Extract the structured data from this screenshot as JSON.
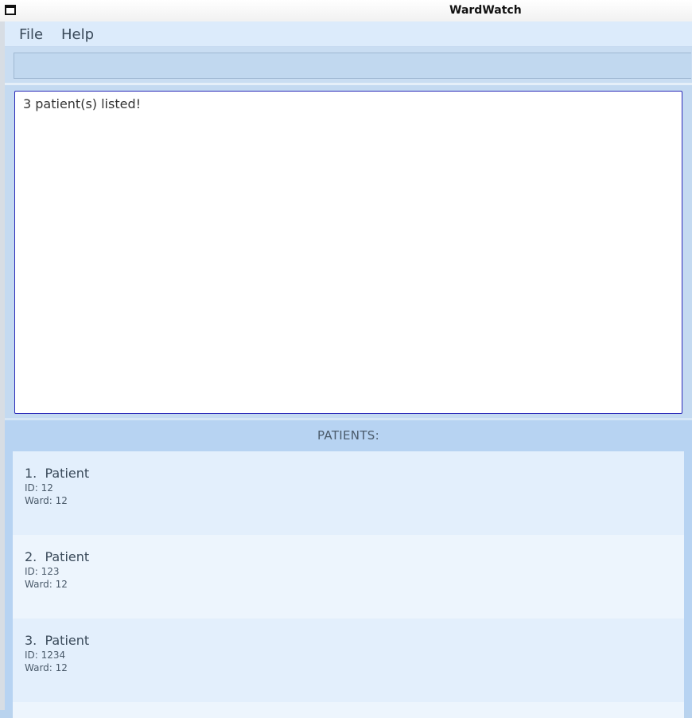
{
  "window": {
    "title": "WardWatch"
  },
  "menu": {
    "file_label": "File",
    "help_label": "Help"
  },
  "command_box": {
    "value": ""
  },
  "result": {
    "text": "3 patient(s) listed!"
  },
  "patient_list": {
    "header": "PATIENTS:",
    "patients": [
      {
        "index": "1.",
        "name": "Patient",
        "id": "ID: 12",
        "ward": "Ward: 12"
      },
      {
        "index": "2.",
        "name": "Patient",
        "id": "ID: 123",
        "ward": "Ward: 12"
      },
      {
        "index": "3.",
        "name": "Patient",
        "id": "ID: 1234",
        "ward": "Ward: 12"
      }
    ]
  },
  "colors": {
    "result_border": "#2a2ab8",
    "accent_bg": "#b7d3f2"
  }
}
